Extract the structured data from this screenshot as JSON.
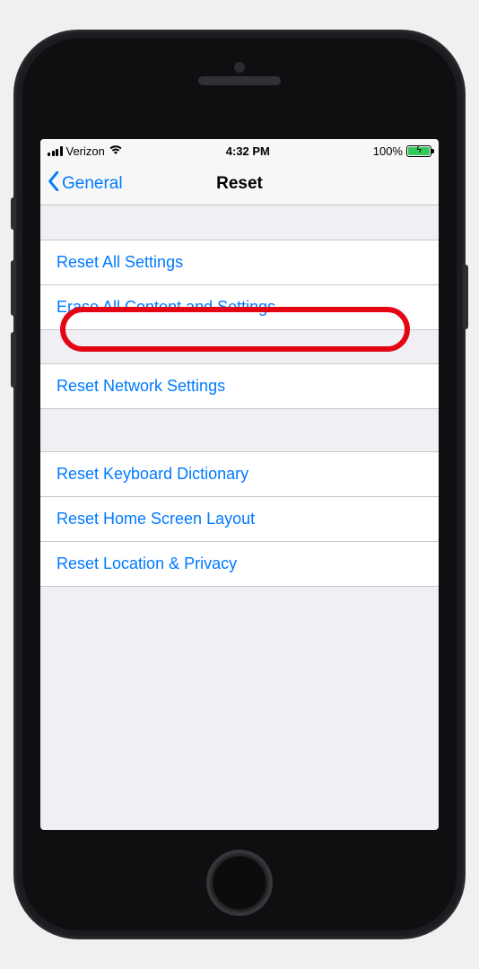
{
  "status_bar": {
    "carrier": "Verizon",
    "time": "4:32 PM",
    "battery_pct": "100%"
  },
  "nav": {
    "back_label": "General",
    "title": "Reset"
  },
  "groups": [
    {
      "items": [
        {
          "label": "Reset All Settings"
        },
        {
          "label": "Erase All Content and Settings"
        }
      ]
    },
    {
      "items": [
        {
          "label": "Reset Network Settings"
        }
      ]
    },
    {
      "items": [
        {
          "label": "Reset Keyboard Dictionary"
        },
        {
          "label": "Reset Home Screen Layout"
        },
        {
          "label": "Reset Location & Privacy"
        }
      ]
    }
  ],
  "annotation": {
    "highlighted_item": "Erase All Content and Settings"
  }
}
